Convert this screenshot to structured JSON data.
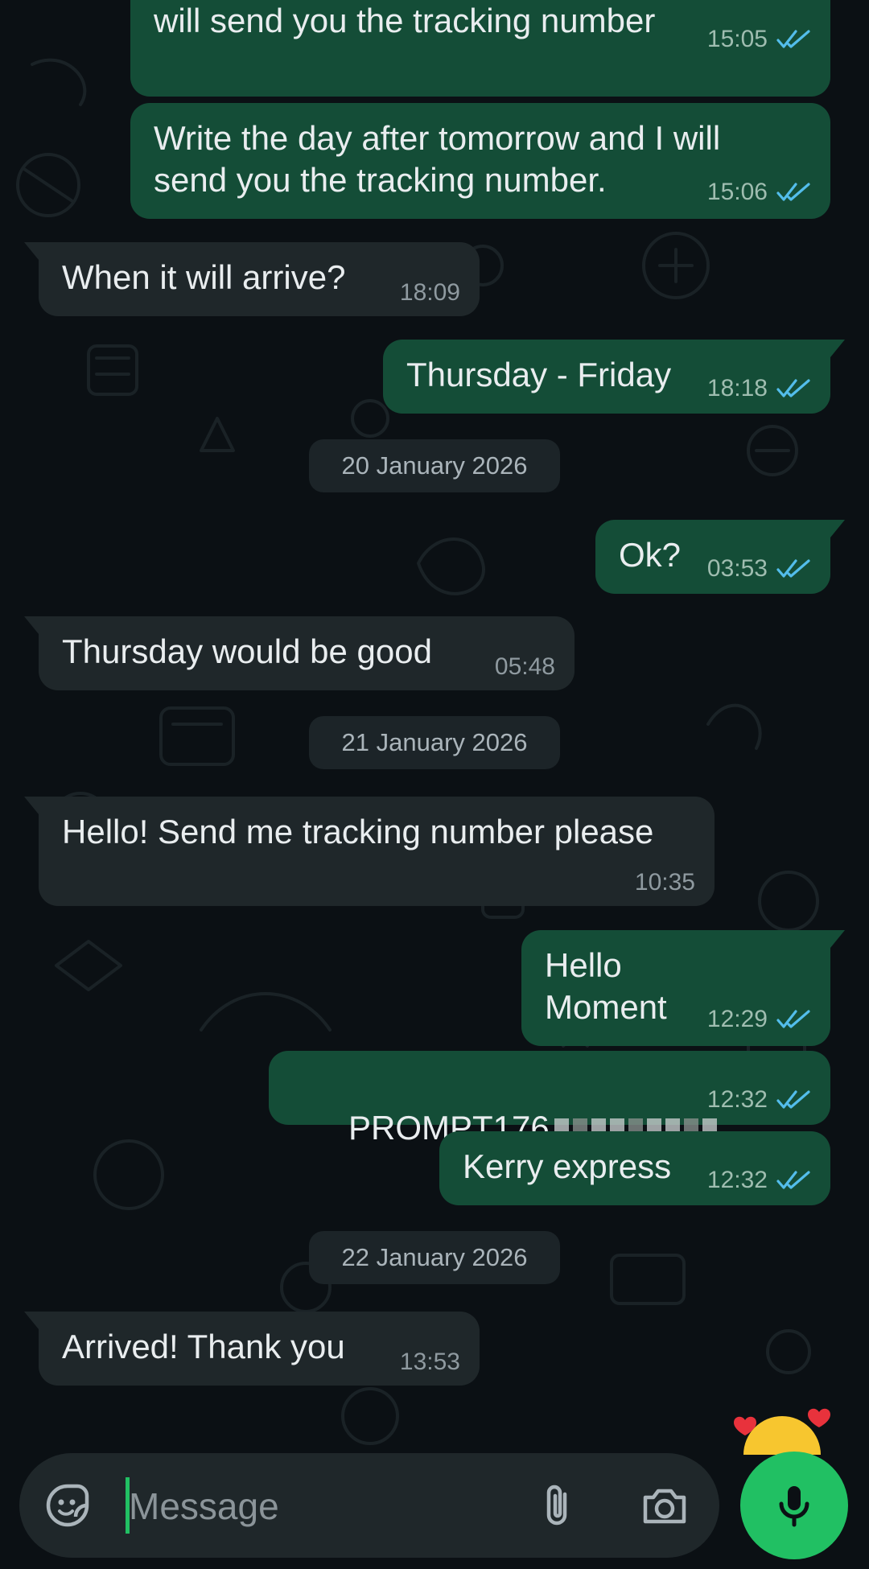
{
  "theme": {
    "outgoing_bubble": "#144d37",
    "incoming_bubble": "#1f272a",
    "read_tick": "#53bdeb",
    "accent": "#21c063"
  },
  "messages": [
    {
      "direction": "out",
      "text": "will send you the tracking number",
      "time": "15:05",
      "read": true
    },
    {
      "direction": "out",
      "text": "Write the day after tomorrow and I will\nsend you the tracking number.",
      "time": "15:06",
      "read": true
    },
    {
      "direction": "in",
      "text": "When it will arrive?",
      "time": "18:09"
    },
    {
      "direction": "out",
      "text": "Thursday - Friday",
      "time": "18:18",
      "read": true
    },
    {
      "direction": "out",
      "text": "Ok?",
      "time": "03:53",
      "read": true
    },
    {
      "direction": "in",
      "text": "Thursday would be good",
      "time": "05:48"
    },
    {
      "direction": "in",
      "text": "Hello! Send me tracking number please",
      "time": "10:35"
    },
    {
      "direction": "out",
      "text": "Hello\nMoment",
      "time": "12:29",
      "read": true
    },
    {
      "direction": "out",
      "text": "PROMPT176",
      "time": "12:32",
      "read": true,
      "redacted": true
    },
    {
      "direction": "out",
      "text": "Kerry express",
      "time": "12:32",
      "read": true
    },
    {
      "direction": "in",
      "text": "Arrived! Thank you",
      "time": "13:53"
    }
  ],
  "date_separators": [
    "20 January 2026",
    "21 January 2026",
    "22 January 2026"
  ],
  "composer": {
    "placeholder": "Message",
    "icons": [
      "sticker-icon",
      "attach-icon",
      "camera-icon",
      "mic-icon"
    ]
  }
}
